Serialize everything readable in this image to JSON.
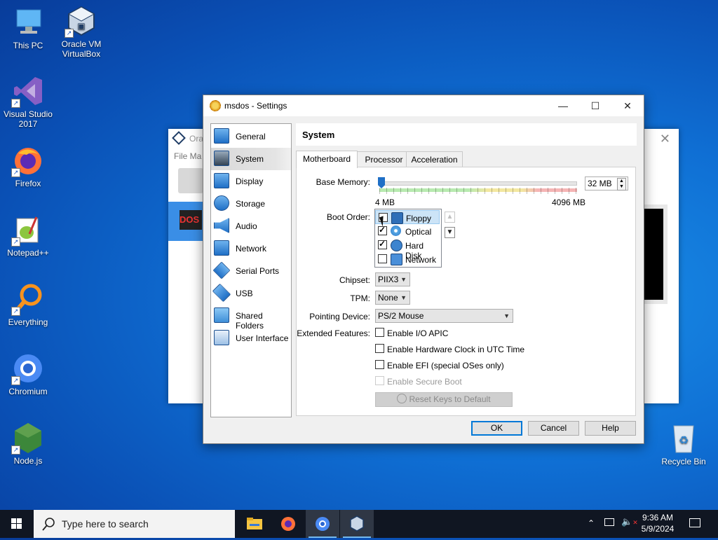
{
  "desktop": {
    "icons": [
      {
        "label": "This PC",
        "name": "this-pc"
      },
      {
        "label": "Oracle VM VirtualBox",
        "name": "virtualbox"
      },
      {
        "label": "Visual Studio 2017",
        "name": "visual-studio"
      },
      {
        "label": "Firefox",
        "name": "firefox"
      },
      {
        "label": "Notepad++",
        "name": "notepadpp"
      },
      {
        "label": "Everything",
        "name": "everything"
      },
      {
        "label": "Chromium",
        "name": "chromium"
      },
      {
        "label": "Node.js",
        "name": "nodejs"
      },
      {
        "label": "Recycle Bin",
        "name": "recycle-bin"
      }
    ]
  },
  "bg_window": {
    "title": "Ora",
    "menu": "File  Ma",
    "vm_thumb": "DOS"
  },
  "dialog": {
    "title": "msdos - Settings",
    "controls": {
      "minimize": "—",
      "maximize": "☐",
      "close": "✕"
    },
    "nav": [
      {
        "label": "General"
      },
      {
        "label": "System"
      },
      {
        "label": "Display"
      },
      {
        "label": "Storage"
      },
      {
        "label": "Audio"
      },
      {
        "label": "Network"
      },
      {
        "label": "Serial Ports"
      },
      {
        "label": "USB"
      },
      {
        "label": "Shared Folders"
      },
      {
        "label": "User Interface"
      }
    ],
    "selected_nav": "System",
    "header": "System",
    "tabs": [
      {
        "label": "Motherboard"
      },
      {
        "label": "Processor"
      },
      {
        "label": "Acceleration"
      }
    ],
    "active_tab": "Motherboard",
    "base_memory": {
      "label": "Base Memory:",
      "value": "32 MB",
      "min_label": "4 MB",
      "max_label": "4096 MB",
      "fraction": 0.007
    },
    "boot_order": {
      "label": "Boot Order:",
      "items": [
        {
          "label": "Floppy",
          "checked": false
        },
        {
          "label": "Optical",
          "checked": true
        },
        {
          "label": "Hard Disk",
          "checked": true
        },
        {
          "label": "Network",
          "checked": false
        }
      ],
      "selected": "Floppy"
    },
    "chipset": {
      "label": "Chipset:",
      "value": "PIIX3"
    },
    "tpm": {
      "label": "TPM:",
      "value": "None"
    },
    "pointing": {
      "label": "Pointing Device:",
      "value": "PS/2 Mouse"
    },
    "extended": {
      "label": "Extended Features:",
      "items": [
        {
          "label": "Enable I/O APIC",
          "checked": false,
          "enabled": true
        },
        {
          "label": "Enable Hardware Clock in UTC Time",
          "checked": false,
          "enabled": true
        },
        {
          "label": "Enable EFI (special OSes only)",
          "checked": false,
          "enabled": true
        },
        {
          "label": "Enable Secure Boot",
          "checked": false,
          "enabled": false
        }
      ]
    },
    "reset_keys": "Reset Keys to Default",
    "buttons": {
      "ok": "OK",
      "cancel": "Cancel",
      "help": "Help"
    }
  },
  "taskbar": {
    "search_placeholder": "Type here to search",
    "time": "9:36 AM",
    "date": "5/9/2024"
  },
  "colors": {
    "accent": "#0078d7",
    "selection": "#cce4f7",
    "desktop": "#0f6fd4"
  }
}
